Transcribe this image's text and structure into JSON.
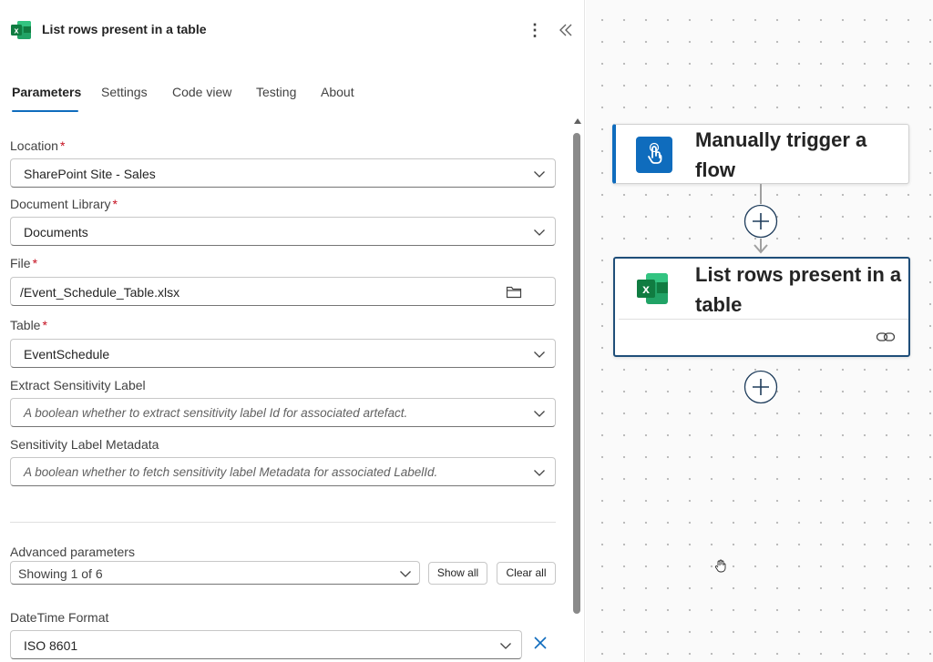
{
  "header": {
    "title": "List rows present in a table",
    "more_label": "⋮"
  },
  "tabs": [
    "Parameters",
    "Settings",
    "Code view",
    "Testing",
    "About"
  ],
  "fields": {
    "location": {
      "label": "Location",
      "required": "*",
      "value": "SharePoint Site - Sales"
    },
    "doc_library": {
      "label": "Document Library",
      "required": "*",
      "value": "Documents"
    },
    "file": {
      "label": "File",
      "required": "*",
      "value": "/Event_Schedule_Table.xlsx"
    },
    "table": {
      "label": "Table",
      "required": "*",
      "value": "EventSchedule"
    },
    "extract_sensitivity": {
      "label": "Extract Sensitivity Label",
      "placeholder": "A boolean whether to extract sensitivity label Id for associated artefact."
    },
    "sensitivity_metadata": {
      "label": "Sensitivity Label Metadata",
      "placeholder": "A boolean whether to fetch sensitivity label Metadata for associated LabelId."
    },
    "datetime_format": {
      "label": "DateTime Format",
      "value": "ISO 8601"
    }
  },
  "advanced": {
    "label": "Advanced parameters",
    "showing": "Showing 1 of 6",
    "show_all": "Show all",
    "clear_all": "Clear all"
  },
  "flow": {
    "trigger_title": "Manually trigger a flow",
    "action_title": "List rows present in a table"
  },
  "colors": {
    "accent": "#0f6cbd",
    "trigger_icon_bg": "#0f6cbd",
    "excel_green": "#107c41"
  },
  "icons": [
    "excel-icon",
    "more-icon",
    "collapse-icon",
    "chevron-down-icon",
    "folder-icon",
    "close-icon",
    "touch-icon",
    "plus-icon",
    "link-icon",
    "hand-cursor-icon"
  ]
}
